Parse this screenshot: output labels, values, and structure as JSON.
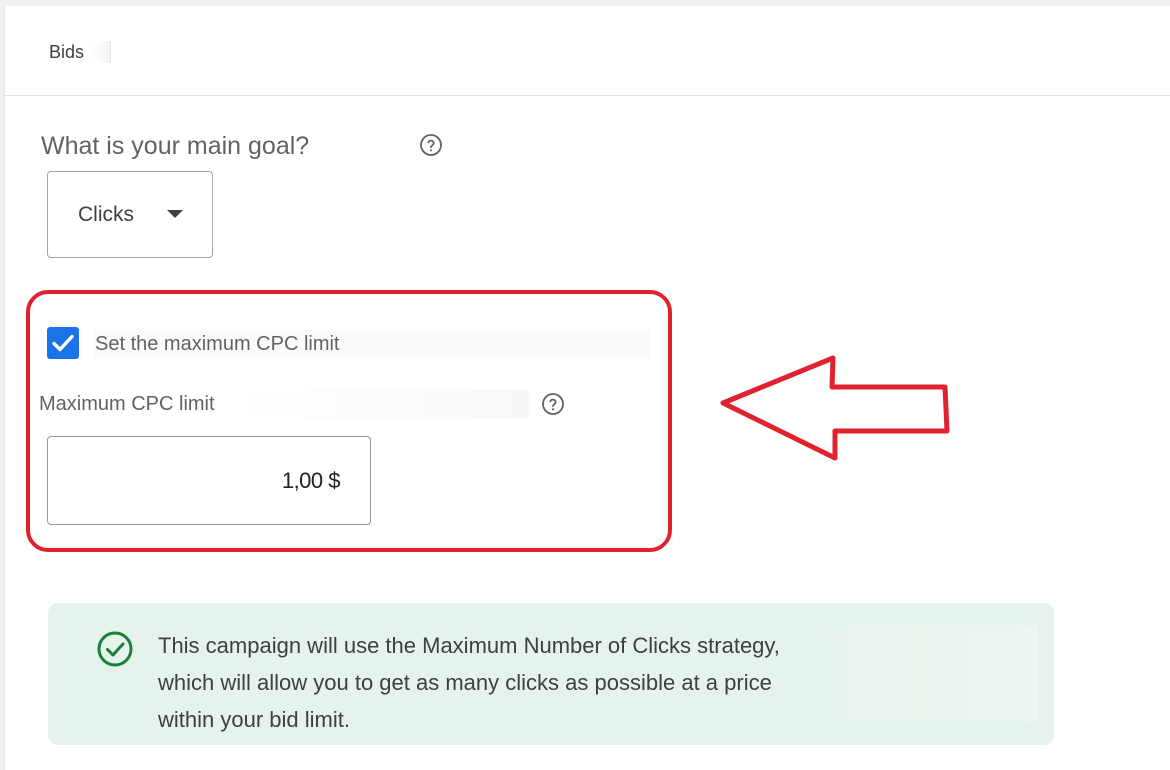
{
  "section": {
    "title": "Bids"
  },
  "goal": {
    "question": "What is your main goal?",
    "help_icon": "help-circle-icon",
    "selected_value": "Clicks"
  },
  "cpc": {
    "checkbox_label": "Set the maximum CPC limit",
    "checked": true,
    "limit_label": "Maximum CPC limit",
    "limit_value": "1,00 $",
    "help_icon": "help-circle-icon"
  },
  "annotation": {
    "highlight_color": "#e0222f",
    "arrow_direction": "left"
  },
  "info": {
    "icon": "check-circle-icon",
    "text": "This campaign will use the Maximum Number of Clicks strategy, which will allow you to get as many clicks as possible at a price within your bid limit."
  },
  "colors": {
    "accent": "#1a73e8",
    "success": "#188038",
    "info_background": "#e6f3ec"
  }
}
